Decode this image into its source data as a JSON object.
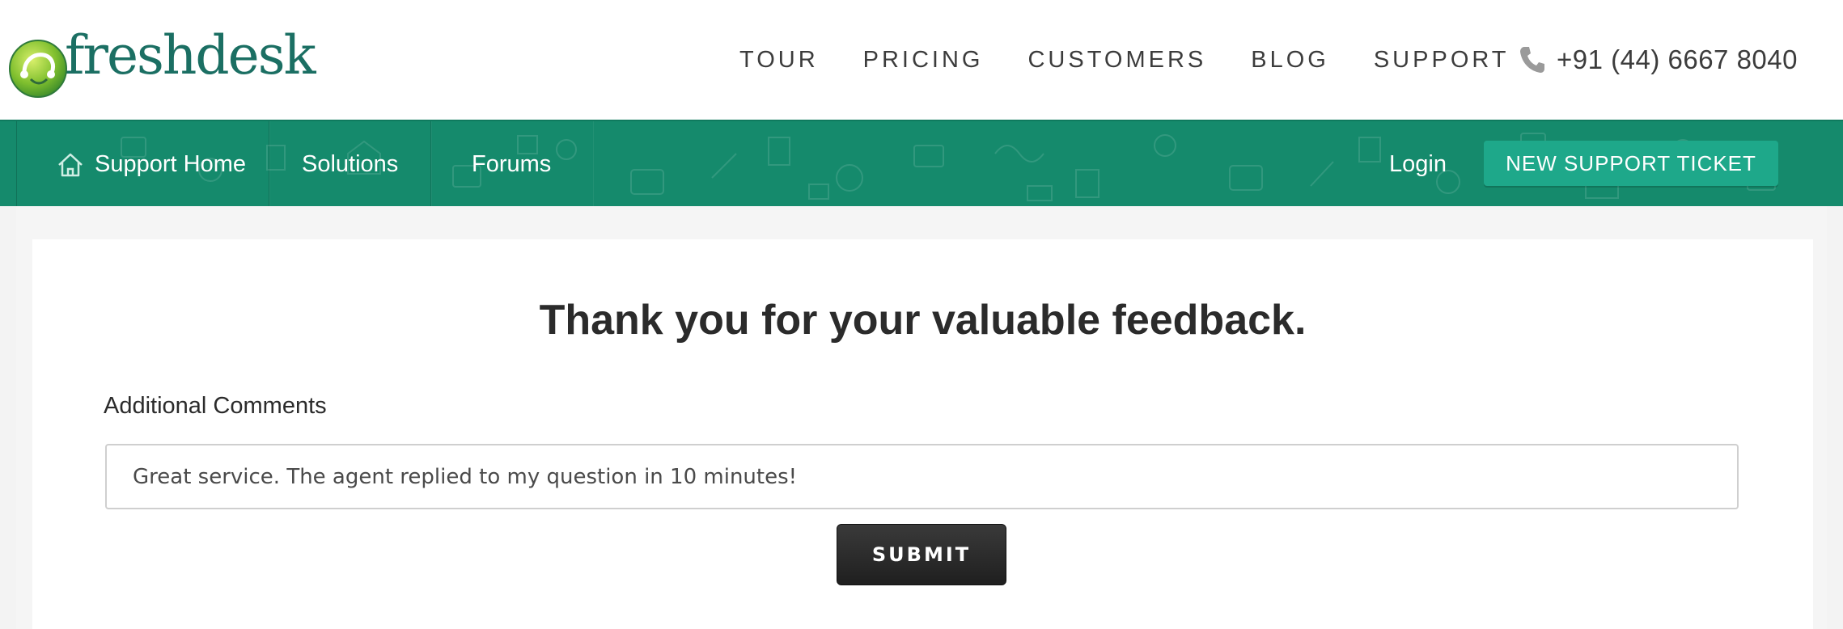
{
  "header": {
    "logo_text": "freshdesk",
    "nav": [
      "TOUR",
      "PRICING",
      "CUSTOMERS",
      "BLOG",
      "SUPPORT"
    ],
    "phone": "+91 (44) 6667 8040"
  },
  "subnav": {
    "support_home": "Support Home",
    "solutions": "Solutions",
    "forums": "Forums",
    "login": "Login",
    "new_ticket": "NEW SUPPORT TICKET"
  },
  "feedback": {
    "title": "Thank you for your valuable feedback.",
    "comments_label": "Additional Comments",
    "comments_value": "Great service. The agent replied to my question in 10 minutes!",
    "submit_label": "SUBMIT"
  },
  "colors": {
    "brand_green": "#158a6c",
    "button_green": "#1ea88a",
    "logo_text": "#1b6f63"
  },
  "icons": [
    "freshdesk-logo-icon",
    "phone-icon",
    "home-icon"
  ]
}
